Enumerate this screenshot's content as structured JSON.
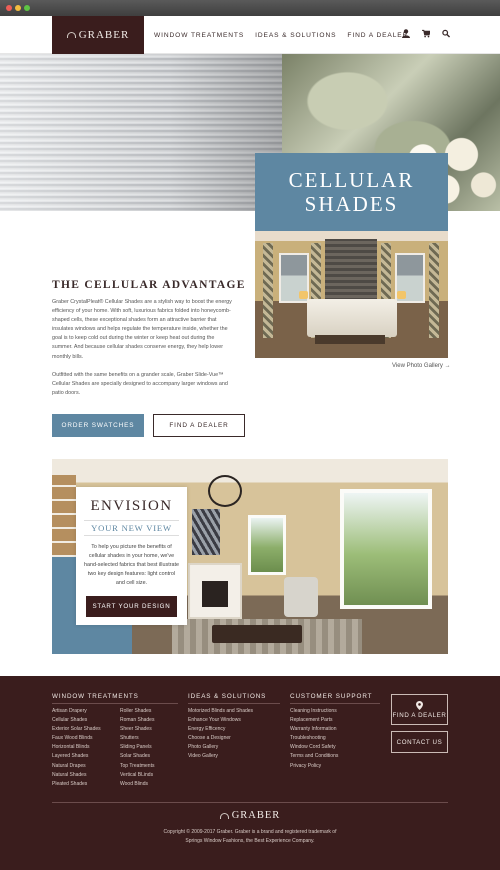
{
  "brand": {
    "name": "GRABER"
  },
  "nav": {
    "items": [
      "WINDOW TREATMENTS",
      "IDEAS & SOLUTIONS",
      "FIND A DEALER"
    ]
  },
  "icons": {
    "account": "user-icon",
    "cart": "cart-icon",
    "search": "search-icon"
  },
  "hero": {
    "title_line1": "CELLULAR",
    "title_line2": "SHADES",
    "gallery_link": "View Photo Gallery →"
  },
  "advantage": {
    "title": "THE CELLULAR ADVANTAGE",
    "para1": "Graber CrystalPleat® Cellular Shades are a stylish way to boost the energy efficiency of your home. With soft, luxurious fabrics folded into honeycomb-shaped cells, these exceptional shades form an attractive barrier that insulates windows and helps regulate the temperature inside, whether the goal is to keep cold out during the winter or keep heat out during the summer. And because cellular shades conserve energy, they help lower monthly bills.",
    "para2": "Outfitted with the same benefits on a grander scale, Graber Slide-Vue™ Cellular Shades are specially designed to accompany larger windows and patio doors.",
    "order_swatches": "ORDER SWATCHES",
    "find_dealer": "FIND A DEALER"
  },
  "envision": {
    "title": "ENVISION",
    "subtitle": "YOUR NEW VIEW",
    "text": "To help you picture the benefits of cellular shades in your home, we've hand-selected fabrics that best illustrate two key design features: light control and cell size.",
    "button": "START YOUR DESIGN"
  },
  "footer": {
    "window_treatments": {
      "heading": "WINDOW TREATMENTS",
      "col1": [
        "Artisan Drapery",
        "Cellular Shades",
        "Exterior Solar Shades",
        "Faux Wood Blinds",
        "Horizontal Blinds",
        "Layered Shades",
        "Natural Drapes",
        "Natural Shades",
        "Pleated Shades"
      ],
      "col2": [
        "Roller Shades",
        "Roman Shades",
        "Sheer Shades",
        "Shutters",
        "Sliding Panels",
        "Solar Shades",
        "Top Treatments",
        "Vertical BLinds",
        "Wood Blinds"
      ]
    },
    "ideas": {
      "heading": "IDEAS & SOLUTIONS",
      "items": [
        "Motorized Blinds and Shades",
        "Enhance Your Windows",
        "Energy Efficency",
        "Choose a Designer",
        "Photo Gallery",
        "Video Gallery"
      ]
    },
    "support": {
      "heading": "CUSTOMER SUPPORT",
      "items": [
        "Cleaning Instructions",
        "Replacement Parts",
        "Warranty Information",
        "Troubleshooting",
        "Window Cord Safety",
        "Terms and Conditions",
        "Privacy Policy"
      ]
    },
    "find_dealer": "FIND A DEALER",
    "contact": "CONTACT US",
    "copyright_line1": "Copyright © 2009-2017 Graber. Graber is a brand and registered trademark of",
    "copyright_line2": "Springs Window Fashions, the Best Experience Company."
  },
  "colors": {
    "brand_dark": "#3a1d1d",
    "accent_blue": "#5e87a2"
  }
}
